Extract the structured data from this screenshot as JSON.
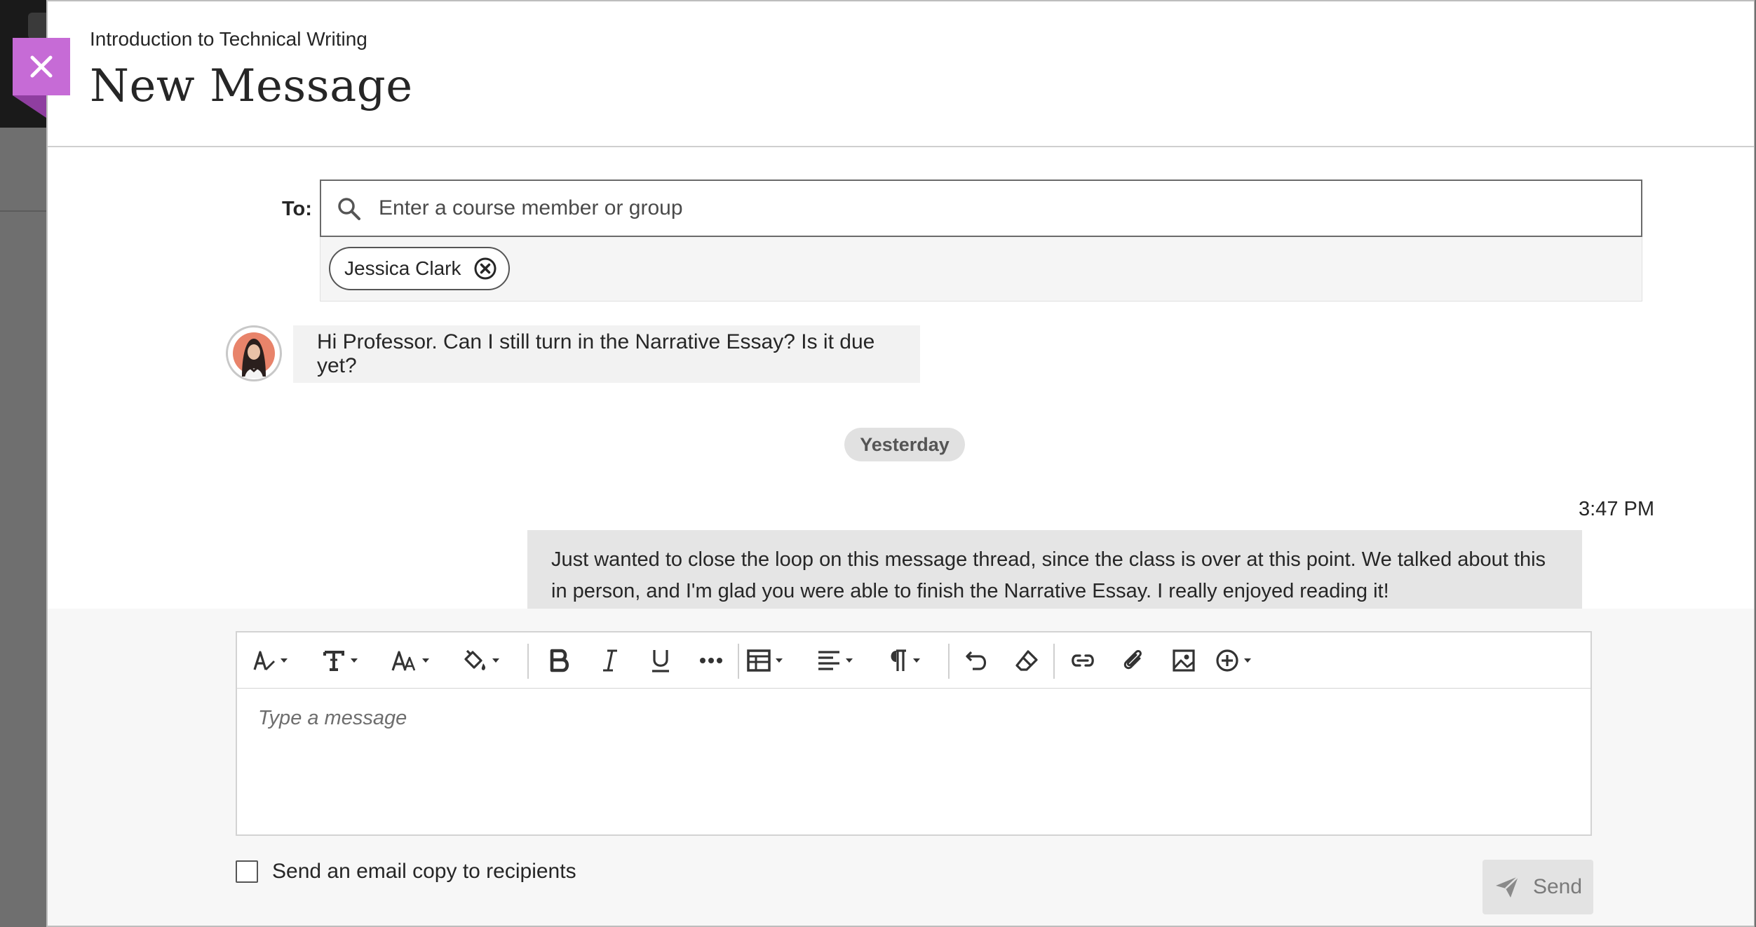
{
  "header": {
    "course_name": "Introduction to Technical Writing",
    "title": "New Message",
    "close_icon": "close-icon",
    "accent_color": "#c66bd6"
  },
  "to_field": {
    "label": "To:",
    "placeholder": "Enter a course member or group",
    "value": "",
    "recipients": [
      {
        "name": "Jessica Clark"
      }
    ]
  },
  "thread": {
    "incoming": {
      "text": "Hi Professor. Can I still turn in the Narrative Essay? Is it due yet?"
    },
    "day_separator": "Yesterday",
    "outgoing": {
      "time": "3:47 PM",
      "text": "Just wanted to close the loop on this message thread, since the class is over at this point. We talked about this in person, and I'm glad you were able to finish the Narrative Essay. I really enjoyed reading it!"
    }
  },
  "editor": {
    "toolbar_icons": [
      "paragraph-style-icon",
      "text-format-icon",
      "font-size-icon",
      "fill-color-icon",
      "bold-icon",
      "italic-icon",
      "underline-icon",
      "more-icon",
      "table-icon",
      "align-icon",
      "paragraph-icon",
      "undo-icon",
      "eraser-icon",
      "link-icon",
      "attachment-icon",
      "image-icon",
      "add-content-icon"
    ],
    "placeholder": "Type a message"
  },
  "footer": {
    "email_copy_label": "Send an email copy to recipients",
    "email_copy_checked": false,
    "send_label": "Send"
  }
}
